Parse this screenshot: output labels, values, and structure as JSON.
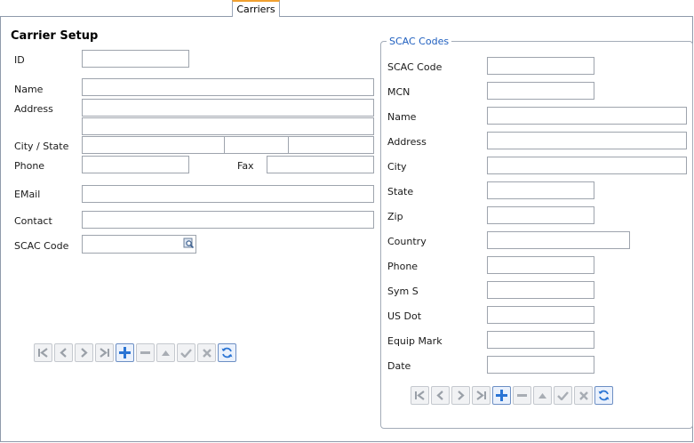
{
  "tab": {
    "label": "Carriers"
  },
  "form": {
    "title": "Carrier Setup",
    "id_label": "ID",
    "id_value": "",
    "name_label": "Name",
    "address_label": "Address",
    "city_state_label": "City / State",
    "phone_label": "Phone",
    "fax_label": "Fax",
    "email_label": "EMail",
    "contact_label": "Contact",
    "scac_label": "SCAC Code"
  },
  "scac": {
    "group_title": "SCAC Codes",
    "fields": {
      "scac_code": "SCAC Code",
      "mcn": "MCN",
      "name": "Name",
      "address": "Address",
      "city": "City",
      "state": "State",
      "zip": "Zip",
      "country": "Country",
      "phone": "Phone",
      "sym_s": "Sym S",
      "us_dot": "US Dot",
      "equip_mark": "Equip Mark",
      "date": "Date"
    }
  },
  "navigator": {
    "buttons": [
      "first",
      "previous",
      "next",
      "last",
      "add",
      "delete",
      "edit",
      "post",
      "cancel",
      "refresh"
    ]
  },
  "colors": {
    "accent": "#f0a030",
    "legend": "#1f5fbf",
    "add": "#2a74d4"
  }
}
